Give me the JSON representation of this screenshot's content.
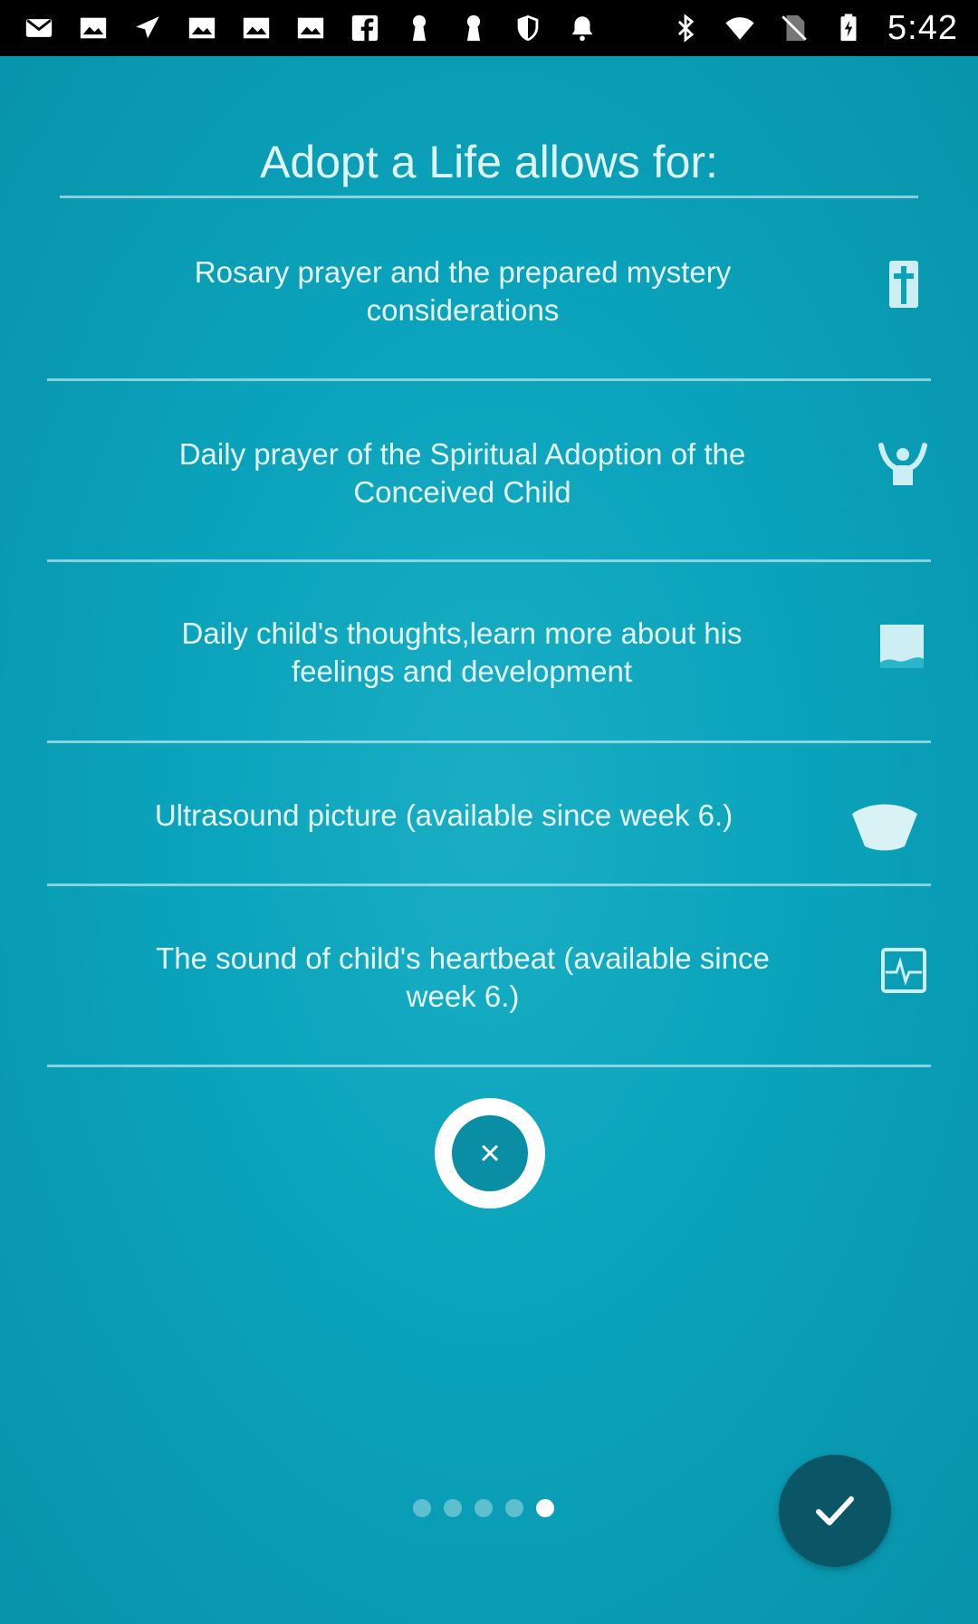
{
  "status_bar": {
    "time": "5:42",
    "left_icons": [
      "mail-icon",
      "photo-icon",
      "send-icon",
      "image-icon",
      "image-icon",
      "image-icon",
      "facebook-icon",
      "keyhole-icon",
      "keyhole-icon",
      "shield-icon",
      "bell-icon"
    ],
    "right_icons": [
      "bluetooth-icon",
      "wifi-icon",
      "no-sim-icon",
      "battery-icon"
    ]
  },
  "heading": "Adopt a Life allows for:",
  "features": [
    {
      "text": "Rosary prayer and the prepared mystery considerations",
      "icon": "cross-icon"
    },
    {
      "text": "Daily prayer of the Spiritual Adoption of the Conceived Child",
      "icon": "praying-person-icon"
    },
    {
      "text": "Daily child's thoughts,learn more about his feelings and development",
      "icon": "note-icon"
    },
    {
      "text": "Ultrasound picture (available since week 6.)",
      "icon": "ultrasound-icon"
    },
    {
      "text": "The sound of child's heartbeat (available since week 6.)",
      "icon": "heartbeat-icon"
    }
  ],
  "close_button": {
    "glyph": "×"
  },
  "page_indicator": {
    "count": 5,
    "active_index": 4
  },
  "colors": {
    "background": "#0aa3bb",
    "text": "#e6f7fa",
    "fab": "#0b5666",
    "close_inner": "#0a8ea5"
  }
}
